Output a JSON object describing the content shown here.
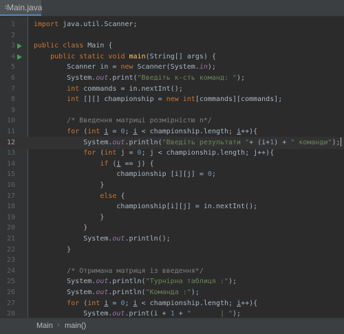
{
  "tab": {
    "label": "Main.java",
    "icon": "java-file-icon"
  },
  "breadcrumb": {
    "class": "Main",
    "method": "main()",
    "separator": "›"
  },
  "current_line": 12,
  "lines": [
    {
      "n": "1",
      "text": "import java.util.Scanner;"
    },
    {
      "n": "2",
      "text": ""
    },
    {
      "n": "3",
      "text": "public class Main {"
    },
    {
      "n": "4",
      "text": "    public static void main(String[] args) {"
    },
    {
      "n": "5",
      "text": "        Scanner in = new Scanner(System.in);"
    },
    {
      "n": "6",
      "text": "        System.out.print(\"Введіть к-сть команд: \");"
    },
    {
      "n": "7",
      "text": "        int commands = in.nextInt();"
    },
    {
      "n": "8",
      "text": "        int [][] championship = new int[commands][commands];"
    },
    {
      "n": "9",
      "text": ""
    },
    {
      "n": "10",
      "text": "        /* Введення матриці розмірністю n*/"
    },
    {
      "n": "11",
      "text": "        for (int i = 0; i < championship.length; i++){"
    },
    {
      "n": "12",
      "text": "            System.out.println(\"Введіть результати \"+ (i+1) + \" команди\");"
    },
    {
      "n": "13",
      "text": "            for (int j = 0; j < championship.length; j++){"
    },
    {
      "n": "14",
      "text": "                if (i == j) {"
    },
    {
      "n": "15",
      "text": "                    championship [i][j] = 0;"
    },
    {
      "n": "16",
      "text": "                }"
    },
    {
      "n": "17",
      "text": "                else {"
    },
    {
      "n": "18",
      "text": "                    championship[i][j] = in.nextInt();"
    },
    {
      "n": "19",
      "text": "                }"
    },
    {
      "n": "20",
      "text": "            }"
    },
    {
      "n": "21",
      "text": "            System.out.println();"
    },
    {
      "n": "22",
      "text": "        }"
    },
    {
      "n": "23",
      "text": ""
    },
    {
      "n": "24",
      "text": "        /* Отримана матриця із введення*/"
    },
    {
      "n": "25",
      "text": "        System.out.println(\"Турнірна таблиця :\");"
    },
    {
      "n": "26",
      "text": "        System.out.println(\"Команда :\");"
    },
    {
      "n": "27",
      "text": "        for (int i = 0; i < championship.length; i++){"
    },
    {
      "n": "28",
      "text": "            System.out.print(i + 1 + \"       | \");"
    }
  ],
  "colors": {
    "background": "#2b2b2b",
    "keyword": "#cc7832",
    "string": "#6a8759",
    "comment": "#808080",
    "static_field": "#9876aa",
    "method": "#ffc66d",
    "number": "#6897bb",
    "run_marker": "#499c54"
  }
}
